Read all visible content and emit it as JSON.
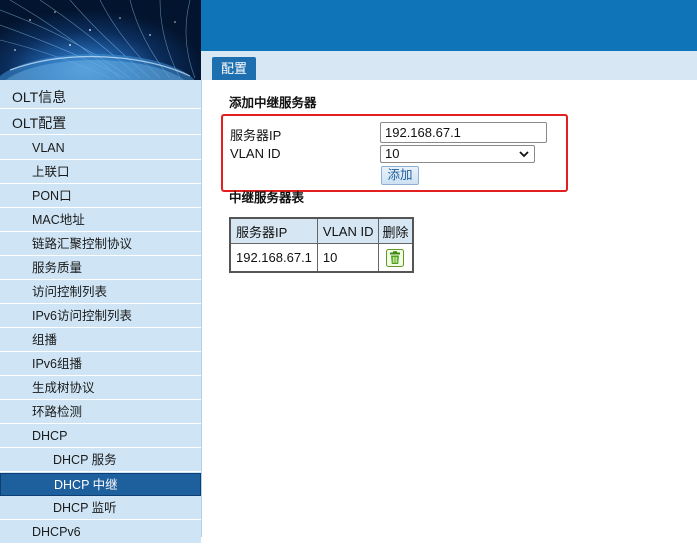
{
  "tab": {
    "label": "配置"
  },
  "sidebar": {
    "items": [
      {
        "label": "OLT信息",
        "level": 1
      },
      {
        "label": "OLT配置",
        "level": 1
      },
      {
        "label": "VLAN",
        "level": 2
      },
      {
        "label": "上联口",
        "level": 2
      },
      {
        "label": "PON口",
        "level": 2
      },
      {
        "label": "MAC地址",
        "level": 2
      },
      {
        "label": "链路汇聚控制协议",
        "level": 2
      },
      {
        "label": "服务质量",
        "level": 2
      },
      {
        "label": "访问控制列表",
        "level": 2
      },
      {
        "label": "IPv6访问控制列表",
        "level": 2
      },
      {
        "label": "组播",
        "level": 2
      },
      {
        "label": "IPv6组播",
        "level": 2
      },
      {
        "label": "生成树协议",
        "level": 2
      },
      {
        "label": "环路检测",
        "level": 2
      },
      {
        "label": "DHCP",
        "level": 2
      },
      {
        "label": "DHCP 服务",
        "level": 3
      },
      {
        "label": "DHCP 中继",
        "level": 3,
        "active": true
      },
      {
        "label": "DHCP 监听",
        "level": 3
      },
      {
        "label": "DHCPv6",
        "level": 2
      }
    ]
  },
  "add_section": {
    "title": "添加中继服务器",
    "server_ip_label": "服务器IP",
    "server_ip_value": "192.168.67.1",
    "vlan_label": "VLAN ID",
    "vlan_value": "10",
    "add_button": "添加"
  },
  "table_section": {
    "title": "中继服务器表",
    "headers": [
      "服务器IP",
      "VLAN ID",
      "删除"
    ],
    "rows": [
      {
        "server_ip": "192.168.67.1",
        "vlan_id": "10",
        "delete_icon": "trash-icon"
      }
    ]
  },
  "colors": {
    "banner_blue": "#0f75b8",
    "sidebar_bg": "#cfe5f5",
    "active_nav": "#1e5f9e",
    "highlight_red": "#e32020"
  }
}
